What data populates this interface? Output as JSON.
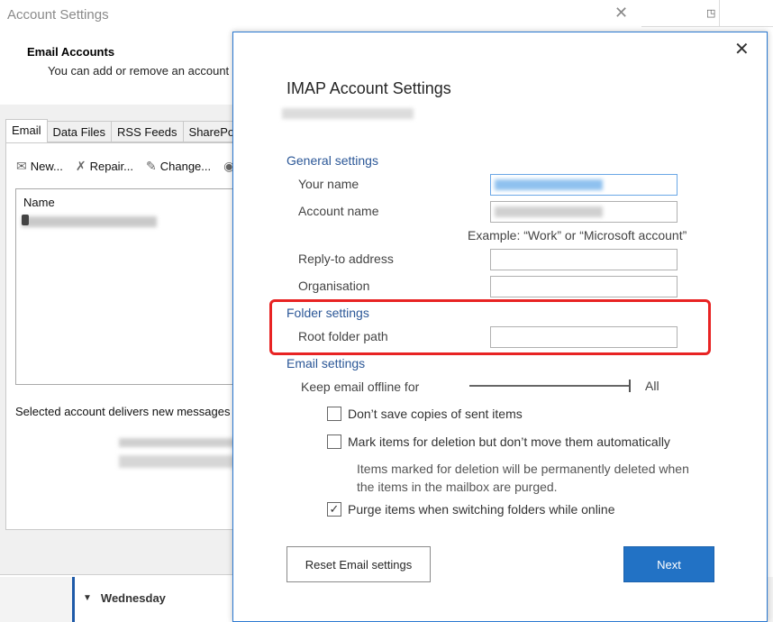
{
  "background": {
    "calendar_day": "Wednesday"
  },
  "account_settings": {
    "title": "Account Settings",
    "heading": "Email Accounts",
    "subheading": "You can add or remove an account",
    "tabs": [
      "Email",
      "Data Files",
      "RSS Feeds",
      "SharePoi"
    ],
    "toolbar": {
      "new_label": "New...",
      "repair_label": "Repair...",
      "change_label": "Change..."
    },
    "list_header": "Name",
    "deliver_text": "Selected account delivers new messages t"
  },
  "imap_dialog": {
    "title": "IMAP Account Settings",
    "general_settings": "General settings",
    "your_name_label": "Your name",
    "account_name_label": "Account name",
    "example_text": "Example: “Work” or “Microsoft account”",
    "reply_to_label": "Reply-to address",
    "organisation_label": "Organisation",
    "folder_settings": "Folder settings",
    "root_folder_label": "Root folder path",
    "email_settings": "Email settings",
    "offline_label": "Keep email offline for",
    "offline_value": "All",
    "dont_save_label": "Don’t save copies of sent items",
    "dont_save_checked": false,
    "mark_deletion_label": "Mark items for deletion but don’t move them automatically",
    "mark_deletion_checked": false,
    "deletion_note": "Items marked for deletion will be permanently deleted when the items in the mailbox are purged.",
    "purge_label": "Purge items when switching folders while online",
    "purge_checked": true,
    "reset_button": "Reset Email settings",
    "next_button": "Next",
    "close_glyph": "✕",
    "check_glyph": "✓"
  },
  "colors": {
    "accent": "#2272c5",
    "section": "#2b5797",
    "highlight": "#e82323"
  }
}
